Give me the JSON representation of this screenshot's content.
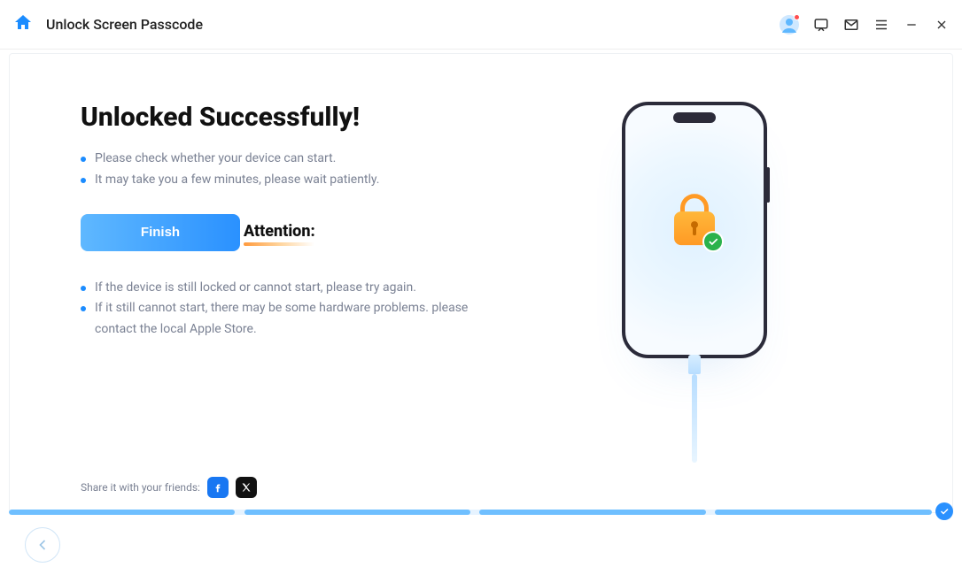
{
  "titlebar": {
    "title": "Unlock Screen Passcode"
  },
  "main": {
    "heading": "Unlocked Successfully!",
    "bullets": [
      "Please check whether your device can start.",
      "It may take you a few minutes, please wait patiently."
    ],
    "finish_label": "Finish",
    "attention_label": "Attention:",
    "attention_items": [
      "If the device is still locked or cannot start, please try again.",
      "If it still cannot start, there may be some hardware problems. please contact the local Apple Store."
    ]
  },
  "share": {
    "label": "Share it with your friends:"
  }
}
